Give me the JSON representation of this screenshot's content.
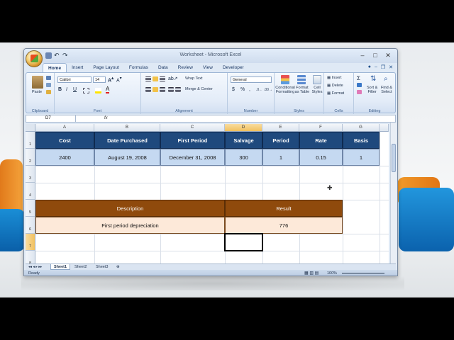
{
  "window": {
    "title": "Worksheet - Microsoft Excel",
    "minimize": "–",
    "maximize": "□",
    "close": "✕"
  },
  "tabs": [
    "Home",
    "Insert",
    "Page Layout",
    "Formulas",
    "Data",
    "Review",
    "View",
    "Developer"
  ],
  "ribbon": {
    "clipboard": {
      "label": "Clipboard",
      "paste": "Paste"
    },
    "font": {
      "label": "Font",
      "name": "Calibri",
      "size": "14",
      "bold": "B",
      "italic": "I",
      "underline": "U"
    },
    "alignment": {
      "label": "Alignment",
      "wrap": "Wrap Text",
      "merge": "Merge & Center"
    },
    "number": {
      "label": "Number",
      "format": "General",
      "currency": "$",
      "percent": "%",
      "comma": ","
    },
    "styles": {
      "label": "Styles",
      "conditional": "Conditional",
      "conditional2": "Formatting",
      "format_table": "Format",
      "format_table2": "as Table",
      "cell_styles": "Cell",
      "cell_styles2": "Styles"
    },
    "cells": {
      "label": "Cells",
      "insert": "Insert",
      "delete": "Delete",
      "format": "Format"
    },
    "editing": {
      "label": "Editing",
      "sort": "Sort &",
      "sort2": "Filter",
      "find": "Find &",
      "find2": "Select"
    }
  },
  "namebox": "D7",
  "fx": "fx",
  "columns": [
    "A",
    "B",
    "C",
    "D",
    "E",
    "F",
    "G"
  ],
  "rows": [
    "1",
    "2",
    "3",
    "4",
    "5",
    "6",
    "7",
    "8"
  ],
  "table1": {
    "headers": [
      "Cost",
      "Date Purchased",
      "First Period",
      "Salvage",
      "Period",
      "Rate",
      "Basis"
    ],
    "values": [
      "2400",
      "August 19, 2008",
      "December 31, 2008",
      "300",
      "1",
      "0.15",
      "1"
    ]
  },
  "table2": {
    "headers": [
      "Description",
      "Result"
    ],
    "values": [
      "First period depreciation",
      "776"
    ]
  },
  "sheets": [
    "Sheet1",
    "Sheet2",
    "Sheet3"
  ],
  "status": {
    "ready": "Ready",
    "zoom": "100%"
  },
  "colors": {
    "header_blue": "#1f497d",
    "value_blue": "#c5d9f1",
    "header_brown": "#8f4a0c",
    "value_peach": "#fde9d9"
  }
}
